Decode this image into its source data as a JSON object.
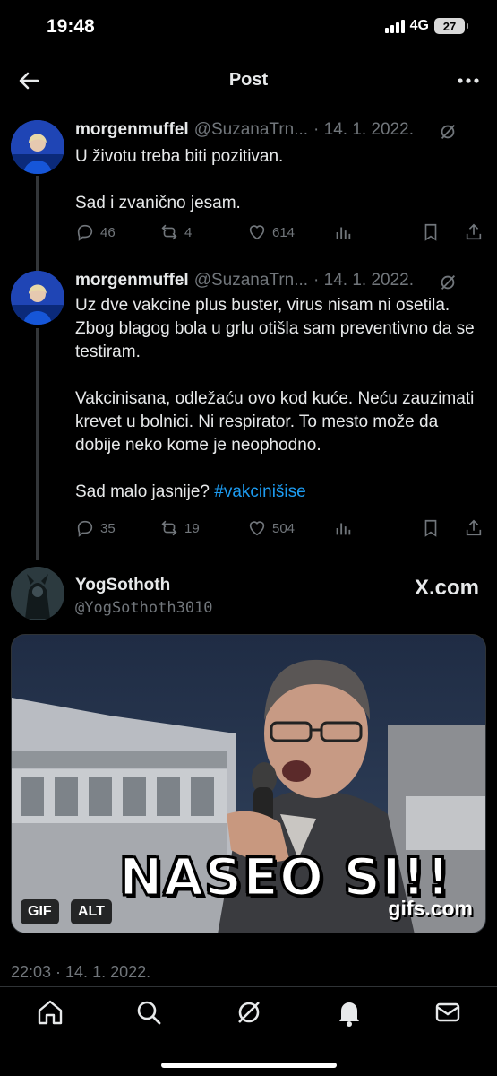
{
  "status_bar": {
    "time": "19:48",
    "network": "4G",
    "battery": "27"
  },
  "header": {
    "title": "Post"
  },
  "tweets": [
    {
      "name": "morgenmuffel",
      "handle": "@SuzanaTrn...",
      "date": "· 14. 1. 2022.",
      "text": "U životu treba biti pozitivan.\n\nSad i zvanično jesam.",
      "hashtag": "",
      "replies": "46",
      "reposts": "4",
      "likes": "614"
    },
    {
      "name": "morgenmuffel",
      "handle": "@SuzanaTrn...",
      "date": "· 14. 1. 2022.",
      "text": "Uz dve vakcine plus buster, virus nisam ni osetila. Zbog blagog bola u grlu otišla sam preventivno da se testiram.\n\nVakcinisana, odležaću ovo kod kuće. Neću zauzimati krevet u bolnici. Ni respirator. To mesto može da dobije neko kome je neophodno.\n\nSad malo jasnije? ",
      "hashtag": "#vakcinišise",
      "replies": "35",
      "reposts": "19",
      "likes": "504"
    }
  ],
  "main_post": {
    "name": "YogSothoth",
    "handle": "@YogSothoth3010",
    "source": "X.com",
    "gif_caption": "NASEO SI!!",
    "gif_watermark": "gifs.com",
    "gif_badge": "GIF",
    "alt_badge": "ALT",
    "timestamp": "22:03 · 14. 1. 2022."
  },
  "colors": {
    "accent": "#1d9bf0",
    "muted": "#71767b",
    "text": "#e7e9ea",
    "background": "#000000"
  },
  "bottom_nav": [
    "home-icon",
    "search-icon",
    "grok-icon",
    "notifications-icon",
    "messages-icon"
  ]
}
